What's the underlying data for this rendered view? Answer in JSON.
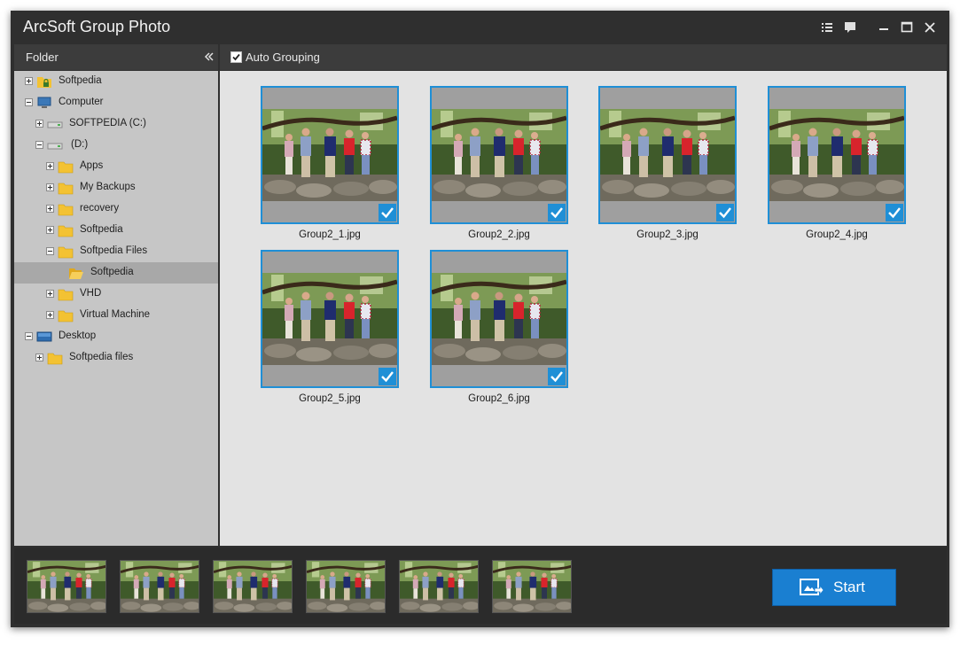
{
  "window": {
    "title": "ArcSoft Group Photo"
  },
  "folder_panel": {
    "header": "Folder",
    "tree": [
      {
        "label": "Softpedia",
        "icon": "locked-folder-icon",
        "expander": "plus",
        "level": 0
      },
      {
        "label": "Computer",
        "icon": "computer-icon",
        "expander": "minus",
        "level": 0
      },
      {
        "label": "SOFTPEDIA (C:)",
        "icon": "drive-icon",
        "expander": "plus",
        "level": 1
      },
      {
        "label": "(D:)",
        "icon": "drive-icon",
        "expander": "minus",
        "level": 1
      },
      {
        "label": "Apps",
        "icon": "folder-icon",
        "expander": "plus",
        "level": 2
      },
      {
        "label": "My Backups",
        "icon": "folder-icon",
        "expander": "plus",
        "level": 2
      },
      {
        "label": "recovery",
        "icon": "folder-icon",
        "expander": "plus",
        "level": 2
      },
      {
        "label": "Softpedia",
        "icon": "folder-icon",
        "expander": "plus",
        "level": 2
      },
      {
        "label": "Softpedia Files",
        "icon": "folder-icon",
        "expander": "minus",
        "level": 2
      },
      {
        "label": "Softpedia",
        "icon": "open-folder-icon",
        "expander": "none",
        "level": 3,
        "selected": true
      },
      {
        "label": "VHD",
        "icon": "folder-icon",
        "expander": "plus",
        "level": 2
      },
      {
        "label": "Virtual Machine",
        "icon": "folder-icon",
        "expander": "plus",
        "level": 2
      },
      {
        "label": "Desktop",
        "icon": "desktop-icon",
        "expander": "minus",
        "level": 0
      },
      {
        "label": "Softpedia files",
        "icon": "folder-icon",
        "expander": "plus",
        "level": 1
      }
    ]
  },
  "toolbar": {
    "auto_grouping_label": "Auto Grouping",
    "auto_grouping_checked": true
  },
  "gallery": {
    "items": [
      {
        "filename": "Group2_1.jpg",
        "selected": true
      },
      {
        "filename": "Group2_2.jpg",
        "selected": true
      },
      {
        "filename": "Group2_3.jpg",
        "selected": true
      },
      {
        "filename": "Group2_4.jpg",
        "selected": true
      },
      {
        "filename": "Group2_5.jpg",
        "selected": true
      },
      {
        "filename": "Group2_6.jpg",
        "selected": true
      }
    ]
  },
  "strip": {
    "thumbnail_count": 6
  },
  "actions": {
    "start_label": "Start"
  },
  "colors": {
    "accent": "#1f8fd6",
    "start_button": "#1a7fd1",
    "window_bg": "#2f2f2f",
    "sidebar_bg": "#c6c6c6",
    "gallery_bg": "#e3e3e3"
  }
}
